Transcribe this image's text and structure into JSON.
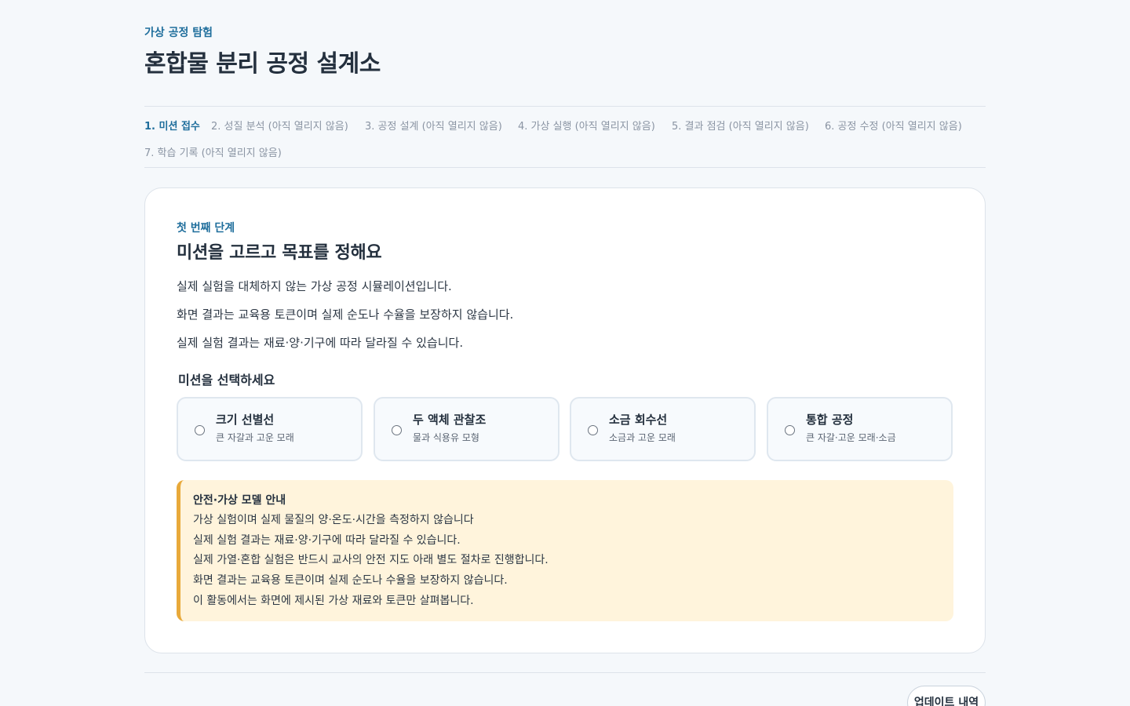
{
  "header": {
    "eyebrow": "가상 공정 탐험",
    "title": "혼합물 분리 공정 설계소"
  },
  "steps": [
    {
      "label": "1. 미션 접수",
      "active": true
    },
    {
      "label": "2. 성질 분석 (아직 열리지 않음)",
      "active": false
    },
    {
      "label": "3. 공정 설계 (아직 열리지 않음)",
      "active": false
    },
    {
      "label": "4. 가상 실행 (아직 열리지 않음)",
      "active": false
    },
    {
      "label": "5. 결과 점검 (아직 열리지 않음)",
      "active": false
    },
    {
      "label": "6. 공정 수정 (아직 열리지 않음)",
      "active": false
    },
    {
      "label": "7. 학습 기록 (아직 열리지 않음)",
      "active": false
    }
  ],
  "card": {
    "kicker": "첫 번째 단계",
    "heading": "미션을 고르고 목표를 정해요",
    "paragraphs": [
      "실제 실험을 대체하지 않는 가상 공정 시뮬레이션입니다.",
      "화면 결과는 교육용 토큰이며 실제 순도나 수율을 보장하지 않습니다.",
      "실제 실험 결과는 재료·양·기구에 따라 달라질 수 있습니다."
    ],
    "choose_label": "미션을 선택하세요",
    "missions": [
      {
        "title": "크기 선별선",
        "desc": "큰 자갈과 고운 모래",
        "selected": false
      },
      {
        "title": "두 액체 관찰조",
        "desc": "물과 식용유 모형",
        "selected": false
      },
      {
        "title": "소금 회수선",
        "desc": "소금과 고운 모래",
        "selected": false
      },
      {
        "title": "통합 공정",
        "desc": "큰 자갈·고운 모래·소금",
        "selected": false
      }
    ],
    "notice": {
      "title": "안전·가상 모델 안내",
      "lines": [
        "가상 실험이며 실제 물질의 양·온도·시간을 측정하지 않습니다",
        "실제 실험 결과는 재료·양·기구에 따라 달라질 수 있습니다.",
        "실제 가열·혼합 실험은 반드시 교사의 안전 지도 아래 별도 절차로 진행합니다.",
        "화면 결과는 교육용 토큰이며 실제 순도나 수율을 보장하지 않습니다.",
        "이 활동에서는 화면에 제시된 가상 재료와 토큰만 살펴봅니다."
      ]
    }
  },
  "footer": {
    "update_label": "업데이트 내역"
  },
  "colors": {
    "accent": "#1f6e9c",
    "notice_bg": "#fff4dc",
    "notice_border": "#e8a93a",
    "page_bg": "#f5f8fb"
  }
}
